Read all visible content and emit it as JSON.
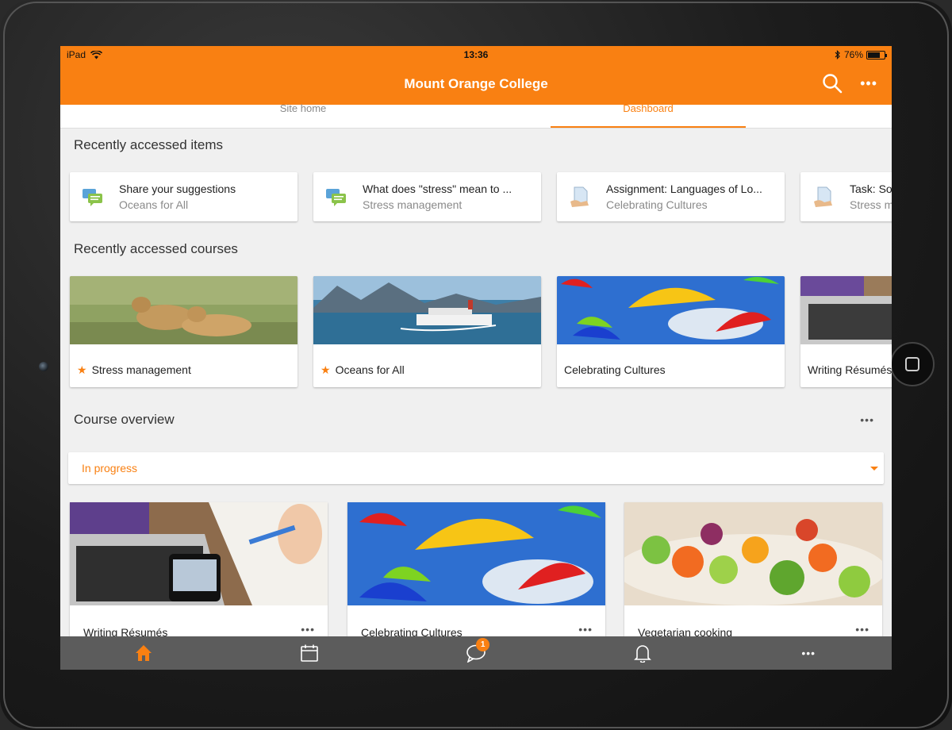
{
  "status_bar": {
    "device": "iPad",
    "time": "13:36",
    "battery": "76%",
    "battery_level": 0.76
  },
  "app_bar": {
    "title": "Mount Orange College",
    "search_icon": "search-icon",
    "more_icon": "more-icon"
  },
  "tabs": [
    {
      "label": "Site home",
      "active": false
    },
    {
      "label": "Dashboard",
      "active": true
    }
  ],
  "recent_items": {
    "heading": "Recently accessed items",
    "items": [
      {
        "title": "Share your suggestions",
        "course": "Oceans for All",
        "icon": "forum-icon"
      },
      {
        "title": "What does \"stress\" mean to ...",
        "course": "Stress management",
        "icon": "forum-icon"
      },
      {
        "title": "Assignment: Languages of Lo...",
        "course": "Celebrating Cultures",
        "icon": "assignment-icon"
      },
      {
        "title": "Task: So",
        "course": "Stress m",
        "icon": "assignment-icon"
      }
    ]
  },
  "recent_courses": {
    "heading": "Recently accessed courses",
    "items": [
      {
        "name": "Stress management",
        "starred": true
      },
      {
        "name": "Oceans for All",
        "starred": true
      },
      {
        "name": "Celebrating Cultures",
        "starred": false
      },
      {
        "name": "Writing Résumés",
        "starred": false
      }
    ]
  },
  "course_overview": {
    "heading": "Course overview",
    "filter": "In progress",
    "courses": [
      {
        "name": "Writing Résumés"
      },
      {
        "name": "Celebrating Cultures"
      },
      {
        "name": "Vegetarian cooking"
      }
    ]
  },
  "tab_bar": {
    "items": [
      {
        "icon": "home-icon",
        "active": true
      },
      {
        "icon": "calendar-icon",
        "active": false
      },
      {
        "icon": "messages-icon",
        "badge": "1"
      },
      {
        "icon": "bell-icon",
        "active": false
      },
      {
        "icon": "more-icon",
        "active": false
      }
    ]
  },
  "colors": {
    "brand": "#f98012",
    "tabbar": "#5c5c5c",
    "background": "#f0f0f0"
  }
}
